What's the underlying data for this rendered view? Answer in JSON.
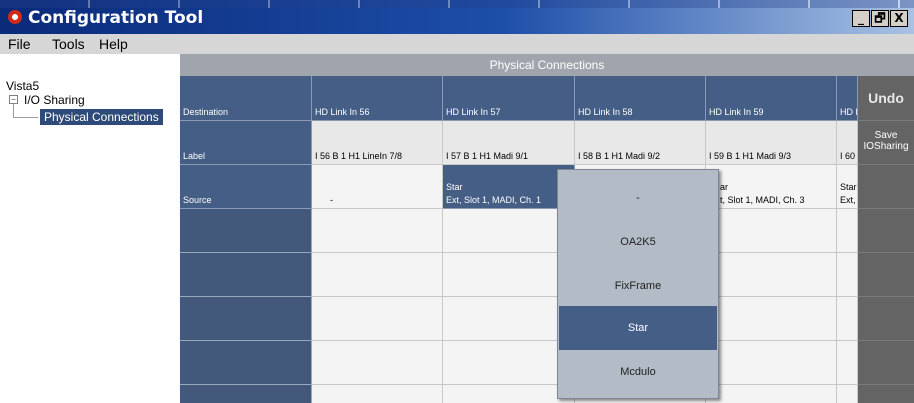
{
  "window": {
    "title": "Configuration Tool",
    "controls": [
      "_",
      "🗗",
      "X"
    ]
  },
  "menu": [
    "File",
    "Tools",
    "Help"
  ],
  "panel_title": "Physical Connections",
  "tree": {
    "root": "Vista5",
    "group": "I/O Sharing",
    "selected": "Physical Connections"
  },
  "grid": {
    "row_headers": [
      "Destination",
      "Label",
      "Source"
    ],
    "columns": [
      {
        "destination": "HD Link In 56",
        "label": "I 56 B 1 H1 LineIn 7/8",
        "source": "-"
      },
      {
        "destination": "HD Link In 57",
        "label": "I 57 B 1 H1 Madi 9/1",
        "source": "Star",
        "source_detail": "Ext, Slot 1, MADI, Ch. 1"
      },
      {
        "destination": "HD Link In 58",
        "label": "I 58 B 1 H1 Madi 9/2",
        "source": ""
      },
      {
        "destination": "HD Link In 59",
        "label": "I 59 B 1 H1 Madi 9/3",
        "source": "ar",
        "source_detail": "t, Slot 1, MADI, Ch. 3"
      },
      {
        "destination": "HD l",
        "label": "I 60",
        "source": "Star",
        "source_detail": "Ext,"
      }
    ]
  },
  "side_buttons": {
    "undo": "Undo",
    "save": "Save IOSharing"
  },
  "dropdown": {
    "options": [
      "-",
      "OA2K5",
      "FixFrame",
      "Star",
      "Mcdulo"
    ],
    "selected": "Star"
  }
}
